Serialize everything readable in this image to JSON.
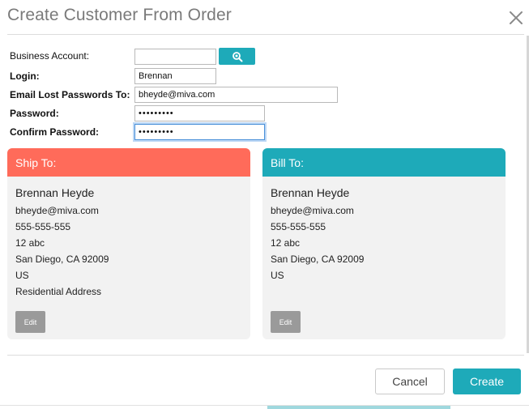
{
  "dialog": {
    "title": "Create Customer From Order"
  },
  "form": {
    "business_account_label": "Business Account:",
    "business_account_value": "",
    "login_label": "Login:",
    "login_value": "Brennan",
    "email_label": "Email Lost Passwords To:",
    "email_value": "bheyde@miva.com",
    "password_label": "Password:",
    "password_value": "•••••••••",
    "confirm_label": "Confirm Password:",
    "confirm_value": "•••••••••"
  },
  "ship_to": {
    "header": "Ship To:",
    "header_color": "#ff6b5a",
    "name": "Brennan Heyde",
    "lines": [
      "bheyde@miva.com",
      "555-555-555",
      "12 abc",
      "San Diego, CA 92009",
      "US",
      "Residential Address"
    ],
    "edit_label": "Edit"
  },
  "bill_to": {
    "header": "Bill To:",
    "header_color": "#1eaab9",
    "name": "Brennan Heyde",
    "lines": [
      "bheyde@miva.com",
      "555-555-555",
      "12 abc",
      "San Diego, CA 92009",
      "US"
    ],
    "edit_label": "Edit"
  },
  "footer": {
    "cancel_label": "Cancel",
    "create_label": "Create"
  },
  "colors": {
    "accent": "#1eaab9",
    "ship_header": "#ff6b5a"
  },
  "icons": {
    "close": "close-icon",
    "search": "search-icon"
  }
}
